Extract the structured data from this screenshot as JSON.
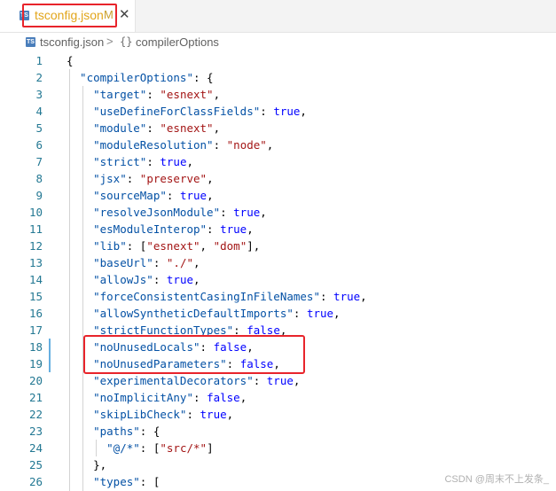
{
  "tab": {
    "icon_label": "TS",
    "filename": "tsconfig.json",
    "modified_marker": "M",
    "close_glyph": "✕"
  },
  "breadcrumb": {
    "file": "tsconfig.json",
    "separator": ">",
    "symbol_glyph": "{}",
    "symbol": "compilerOptions"
  },
  "editor": {
    "lines": [
      {
        "num": "1",
        "tokens": [
          {
            "t": "p",
            "v": "{"
          }
        ]
      },
      {
        "num": "2",
        "tokens": [
          {
            "t": "k",
            "v": "  \"compilerOptions\""
          },
          {
            "t": "p",
            "v": ": {"
          }
        ]
      },
      {
        "num": "3",
        "tokens": [
          {
            "t": "k",
            "v": "    \"target\""
          },
          {
            "t": "p",
            "v": ": "
          },
          {
            "t": "s",
            "v": "\"esnext\""
          },
          {
            "t": "p",
            "v": ","
          }
        ]
      },
      {
        "num": "4",
        "tokens": [
          {
            "t": "k",
            "v": "    \"useDefineForClassFields\""
          },
          {
            "t": "p",
            "v": ": "
          },
          {
            "t": "b",
            "v": "true"
          },
          {
            "t": "p",
            "v": ","
          }
        ]
      },
      {
        "num": "5",
        "tokens": [
          {
            "t": "k",
            "v": "    \"module\""
          },
          {
            "t": "p",
            "v": ": "
          },
          {
            "t": "s",
            "v": "\"esnext\""
          },
          {
            "t": "p",
            "v": ","
          }
        ]
      },
      {
        "num": "6",
        "tokens": [
          {
            "t": "k",
            "v": "    \"moduleResolution\""
          },
          {
            "t": "p",
            "v": ": "
          },
          {
            "t": "s",
            "v": "\"node\""
          },
          {
            "t": "p",
            "v": ","
          }
        ]
      },
      {
        "num": "7",
        "tokens": [
          {
            "t": "k",
            "v": "    \"strict\""
          },
          {
            "t": "p",
            "v": ": "
          },
          {
            "t": "b",
            "v": "true"
          },
          {
            "t": "p",
            "v": ","
          }
        ]
      },
      {
        "num": "8",
        "tokens": [
          {
            "t": "k",
            "v": "    \"jsx\""
          },
          {
            "t": "p",
            "v": ": "
          },
          {
            "t": "s",
            "v": "\"preserve\""
          },
          {
            "t": "p",
            "v": ","
          }
        ]
      },
      {
        "num": "9",
        "tokens": [
          {
            "t": "k",
            "v": "    \"sourceMap\""
          },
          {
            "t": "p",
            "v": ": "
          },
          {
            "t": "b",
            "v": "true"
          },
          {
            "t": "p",
            "v": ","
          }
        ]
      },
      {
        "num": "10",
        "tokens": [
          {
            "t": "k",
            "v": "    \"resolveJsonModule\""
          },
          {
            "t": "p",
            "v": ": "
          },
          {
            "t": "b",
            "v": "true"
          },
          {
            "t": "p",
            "v": ","
          }
        ]
      },
      {
        "num": "11",
        "tokens": [
          {
            "t": "k",
            "v": "    \"esModuleInterop\""
          },
          {
            "t": "p",
            "v": ": "
          },
          {
            "t": "b",
            "v": "true"
          },
          {
            "t": "p",
            "v": ","
          }
        ]
      },
      {
        "num": "12",
        "tokens": [
          {
            "t": "k",
            "v": "    \"lib\""
          },
          {
            "t": "p",
            "v": ": ["
          },
          {
            "t": "s",
            "v": "\"esnext\""
          },
          {
            "t": "p",
            "v": ", "
          },
          {
            "t": "s",
            "v": "\"dom\""
          },
          {
            "t": "p",
            "v": "],"
          }
        ]
      },
      {
        "num": "13",
        "tokens": [
          {
            "t": "k",
            "v": "    \"baseUrl\""
          },
          {
            "t": "p",
            "v": ": "
          },
          {
            "t": "s",
            "v": "\"./\""
          },
          {
            "t": "p",
            "v": ","
          }
        ]
      },
      {
        "num": "14",
        "tokens": [
          {
            "t": "k",
            "v": "    \"allowJs\""
          },
          {
            "t": "p",
            "v": ": "
          },
          {
            "t": "b",
            "v": "true"
          },
          {
            "t": "p",
            "v": ","
          }
        ]
      },
      {
        "num": "15",
        "tokens": [
          {
            "t": "k",
            "v": "    \"forceConsistentCasingInFileNames\""
          },
          {
            "t": "p",
            "v": ": "
          },
          {
            "t": "b",
            "v": "true"
          },
          {
            "t": "p",
            "v": ","
          }
        ]
      },
      {
        "num": "16",
        "tokens": [
          {
            "t": "k",
            "v": "    \"allowSyntheticDefaultImports\""
          },
          {
            "t": "p",
            "v": ": "
          },
          {
            "t": "b",
            "v": "true"
          },
          {
            "t": "p",
            "v": ","
          }
        ]
      },
      {
        "num": "17",
        "tokens": [
          {
            "t": "k",
            "v": "    \"strictFunctionTypes\""
          },
          {
            "t": "p",
            "v": ": "
          },
          {
            "t": "b",
            "v": "false"
          },
          {
            "t": "p",
            "v": ","
          }
        ]
      },
      {
        "num": "18",
        "tokens": [
          {
            "t": "k",
            "v": "    \"noUnusedLocals\""
          },
          {
            "t": "p",
            "v": ": "
          },
          {
            "t": "b",
            "v": "false"
          },
          {
            "t": "p",
            "v": ","
          }
        ]
      },
      {
        "num": "19",
        "tokens": [
          {
            "t": "k",
            "v": "    \"noUnusedParameters\""
          },
          {
            "t": "p",
            "v": ": "
          },
          {
            "t": "b",
            "v": "false"
          },
          {
            "t": "p",
            "v": ","
          }
        ]
      },
      {
        "num": "20",
        "tokens": [
          {
            "t": "k",
            "v": "    \"experimentalDecorators\""
          },
          {
            "t": "p",
            "v": ": "
          },
          {
            "t": "b",
            "v": "true"
          },
          {
            "t": "p",
            "v": ","
          }
        ]
      },
      {
        "num": "21",
        "tokens": [
          {
            "t": "k",
            "v": "    \"noImplicitAny\""
          },
          {
            "t": "p",
            "v": ": "
          },
          {
            "t": "b",
            "v": "false"
          },
          {
            "t": "p",
            "v": ","
          }
        ]
      },
      {
        "num": "22",
        "tokens": [
          {
            "t": "k",
            "v": "    \"skipLibCheck\""
          },
          {
            "t": "p",
            "v": ": "
          },
          {
            "t": "b",
            "v": "true"
          },
          {
            "t": "p",
            "v": ","
          }
        ]
      },
      {
        "num": "23",
        "tokens": [
          {
            "t": "k",
            "v": "    \"paths\""
          },
          {
            "t": "p",
            "v": ": {"
          }
        ]
      },
      {
        "num": "24",
        "tokens": [
          {
            "t": "k",
            "v": "      \"@/*\""
          },
          {
            "t": "p",
            "v": ": ["
          },
          {
            "t": "s",
            "v": "\"src/*\""
          },
          {
            "t": "p",
            "v": "]"
          }
        ]
      },
      {
        "num": "25",
        "tokens": [
          {
            "t": "p",
            "v": "    },"
          }
        ]
      },
      {
        "num": "26",
        "tokens": [
          {
            "t": "k",
            "v": "    \"types\""
          },
          {
            "t": "p",
            "v": ": ["
          }
        ]
      }
    ]
  },
  "colors": {
    "key": "#0451a5",
    "string": "#a31515",
    "keyword": "#0000ff",
    "line_number": "#237893",
    "highlight_box": "#e8242b",
    "tab_label": "#e2a51a"
  },
  "watermark": "CSDN @周末不上发条_"
}
